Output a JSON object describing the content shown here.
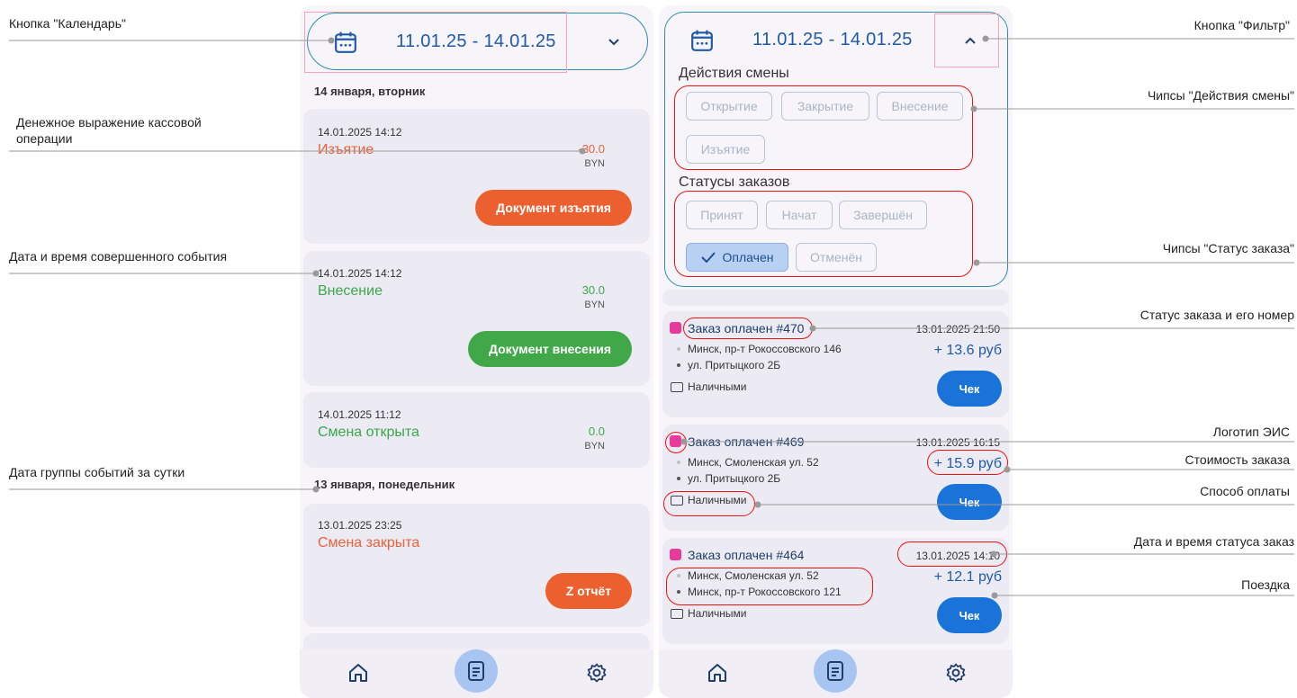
{
  "annotations": {
    "left": [
      "Кнопка \"Календарь\"",
      "Денежное выражение кассовой",
      "операции",
      "Дата и время совершенного события",
      "Дата группы событий за сутки"
    ],
    "right": [
      "Кнопка \"Фильтр\"",
      "Чипсы \"Действия смены\"",
      "Чипсы \"Статус заказа\"",
      "Статус заказа и его номер",
      "Логотип ЭИС",
      "Стоимость заказа",
      "Способ оплаты",
      "Дата и время статуса заказ",
      "Поездка"
    ]
  },
  "left_screen": {
    "date_range": "11.01.25 - 14.01.25",
    "day1": "14 января, вторник",
    "day2": "13 января, понедельник",
    "cards": [
      {
        "date": "14.01.2025 14:12",
        "title": "Изъятие",
        "amount": "-30.0",
        "currency": "BYN",
        "button": "Документ изъятия"
      },
      {
        "date": "14.01.2025 14:12",
        "title": "Внесение",
        "amount": "30.0",
        "currency": "BYN",
        "button": "Документ внесения"
      },
      {
        "date": "14.01.2025 11:12",
        "title": "Смена открыта",
        "amount": "0.0",
        "currency": "BYN"
      },
      {
        "date": "13.01.2025 23:25",
        "title": "Смена закрыта",
        "button": "Z отчёт"
      }
    ]
  },
  "right_screen": {
    "date_range": "11.01.25 - 14.01.25",
    "filter": {
      "shift_actions_title": "Действия смены",
      "shift_chips": [
        "Открытие",
        "Закрытие",
        "Внесение",
        "Изъятие"
      ],
      "order_status_title": "Статусы заказов",
      "status_chips": [
        "Принят",
        "Начат",
        "Завершён"
      ],
      "selected_chip": "Оплачен",
      "cancelled_chip": "Отменён"
    },
    "orders": [
      {
        "title": "Заказ оплачен #470",
        "time": "13.01.2025 21:50",
        "from": "Минск, пр-т Рокоссовского 146",
        "to": "ул. Притыцкого 2Б",
        "price": "+ 13.6 руб",
        "payment": "Наличными",
        "button": "Чек"
      },
      {
        "title": "Заказ оплачен #469",
        "time": "13.01.2025 16:15",
        "from": "Минск, Смоленская ул. 52",
        "to": "ул. Притыцкого 2Б",
        "price": "+ 15.9 руб",
        "payment": "Наличными",
        "button": "Чек"
      },
      {
        "title": "Заказ оплачен #464",
        "time": "13.01.2025 14:10",
        "from": "Минск, Смоленская ул. 52",
        "to": "Минск, пр-т Рокоссовского 121",
        "price": "+ 12.1 руб",
        "payment": "Наличными",
        "button": "Чек"
      }
    ]
  },
  "colors": {
    "accent": "#1f5aa8",
    "orange": "#e8623a",
    "green": "#3aa84a",
    "highlight": "#e11111",
    "logo": "#e83a9a"
  },
  "icons": [
    "calendar-icon",
    "chevron-down-icon",
    "chevron-up-icon",
    "home-icon",
    "document-icon",
    "gear-icon",
    "check-icon",
    "cash-icon",
    "eis-logo-icon"
  ]
}
